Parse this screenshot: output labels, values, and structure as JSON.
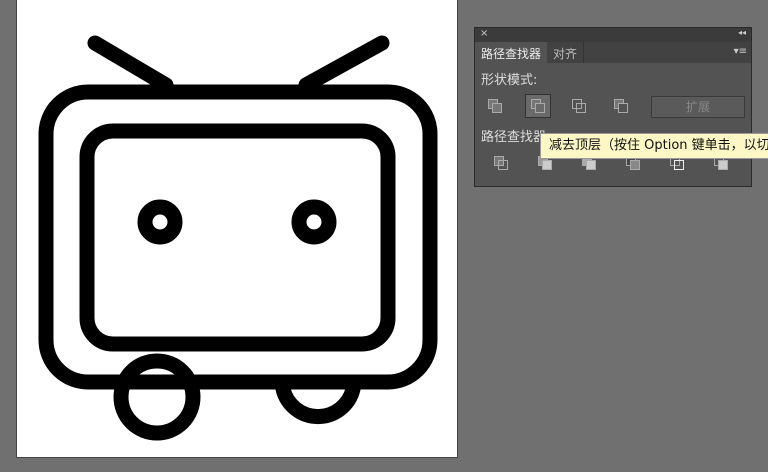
{
  "panel": {
    "close": "×",
    "collapse": "◂◂",
    "tabs": [
      {
        "label": "路径查找器"
      },
      {
        "label": "对齐"
      }
    ],
    "menu": "▾≡",
    "shape_modes_label": "形状模式:",
    "expand_label": "扩展",
    "pathfinders_label": "路径查找器:"
  },
  "tooltip": "减去顶层（按住 Option 键单击，以切换"
}
